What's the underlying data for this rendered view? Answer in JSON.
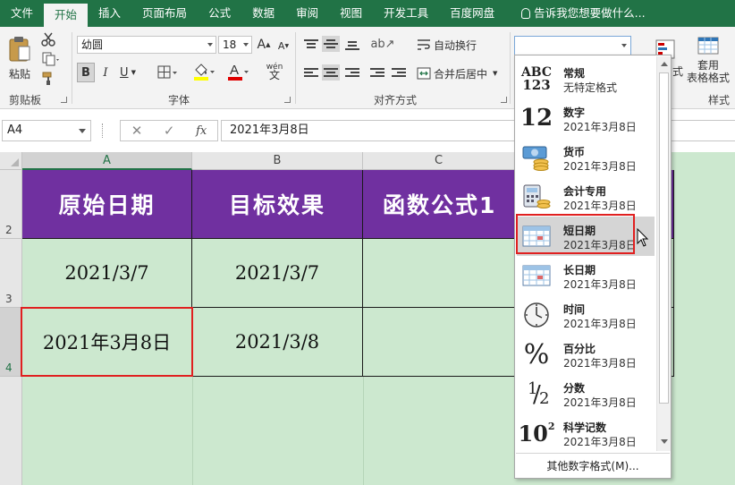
{
  "tabs": [
    "文件",
    "开始",
    "插入",
    "页面布局",
    "公式",
    "数据",
    "审阅",
    "视图",
    "开发工具",
    "百度网盘"
  ],
  "active_tab": 1,
  "tell_me": "告诉我您想要做什么...",
  "ribbon": {
    "paste_label": "粘贴",
    "clipboard_label": "剪贴板",
    "font_label": "字体",
    "font_name": "幼圆",
    "font_size": "18",
    "bold": "B",
    "italic": "I",
    "underline": "U",
    "font_grow": "A",
    "font_shrink": "A",
    "phonetic": "wén",
    "align_label": "对齐方式",
    "wrap_text": "自动换行",
    "merge_center": "合并后居中",
    "style_label": "样式",
    "cond_format_label": "式",
    "table_format_label": "套用\n表格格式"
  },
  "formula_bar": {
    "name_box": "A4",
    "fx": "fx",
    "formula": "2021年3月8日"
  },
  "grid": {
    "columns": [
      "A",
      "B",
      "C"
    ],
    "rows": [
      "2",
      "3",
      "4"
    ],
    "headers": [
      "原始日期",
      "目标效果",
      "函数公式1"
    ],
    "cells": [
      [
        "2021/3/7",
        "2021/3/7",
        ""
      ],
      [
        "2021年3月8日",
        "2021/3/8",
        ""
      ]
    ]
  },
  "number_format_menu": {
    "items": [
      {
        "name": "常规",
        "sample": "无特定格式",
        "icon": "general-icon"
      },
      {
        "name": "数字",
        "sample": "2021年3月8日",
        "icon": "number-icon"
      },
      {
        "name": "货币",
        "sample": "2021年3月8日",
        "icon": "currency-icon"
      },
      {
        "name": "会计专用",
        "sample": "2021年3月8日",
        "icon": "accounting-icon"
      },
      {
        "name": "短日期",
        "sample": "2021年3月8日",
        "icon": "calendar-icon"
      },
      {
        "name": "长日期",
        "sample": "2021年3月8日",
        "icon": "calendar-icon"
      },
      {
        "name": "时间",
        "sample": "2021年3月8日",
        "icon": "clock-icon"
      },
      {
        "name": "百分比",
        "sample": "2021年3月8日",
        "icon": "percent-icon"
      },
      {
        "name": "分数",
        "sample": "2021年3月8日",
        "icon": "fraction-icon"
      },
      {
        "name": "科学记数",
        "sample": "2021年3月8日",
        "icon": "scientific-icon"
      }
    ],
    "highlighted_index": 4,
    "more": "其他数字格式(M)..."
  },
  "icon_text": {
    "general": [
      "ABC",
      "123"
    ],
    "number": "12",
    "percent": "%",
    "fraction_num": "1",
    "fraction_den": "2",
    "sci_base": "10",
    "sci_exp": "2"
  },
  "colors": {
    "ribbon_green": "#217346",
    "header_purple": "#7030a0",
    "sheet_green": "#cce8cf",
    "highlight_red": "#e02020"
  }
}
